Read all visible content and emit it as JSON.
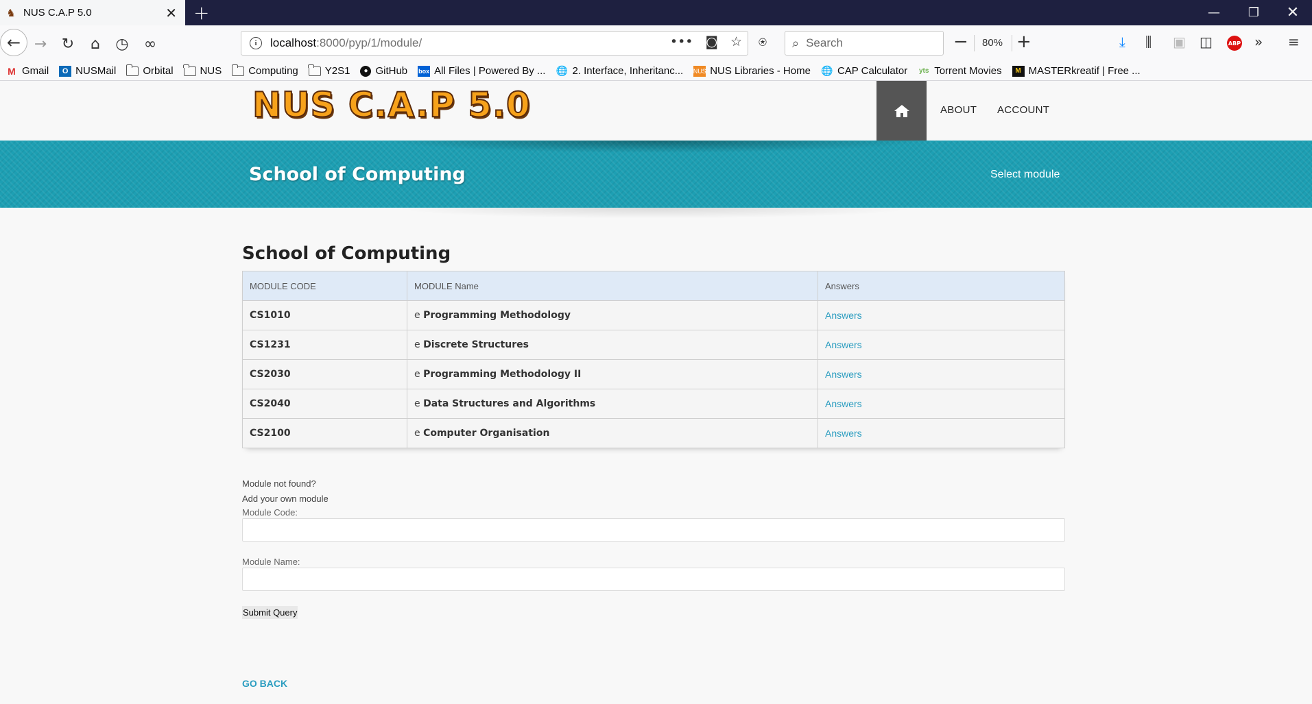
{
  "browser": {
    "tab_title": "NUS C.A.P 5.0",
    "url_host": "localhost",
    "url_path": ":8000/pyp/1/module/",
    "search_placeholder": "Search",
    "zoom": "80%",
    "abp_label": "ABP"
  },
  "bookmarks": [
    {
      "label": "Gmail",
      "icon": "gmail-icon"
    },
    {
      "label": "NUSMail",
      "icon": "outlook-icon"
    },
    {
      "label": "Orbital",
      "icon": "folder-icon"
    },
    {
      "label": "NUS",
      "icon": "folder-icon"
    },
    {
      "label": "Computing",
      "icon": "folder-icon"
    },
    {
      "label": "Y2S1",
      "icon": "folder-icon"
    },
    {
      "label": "GitHub",
      "icon": "github-icon"
    },
    {
      "label": "All Files | Powered By ...",
      "icon": "box-icon"
    },
    {
      "label": "2. Interface, Inheritanc...",
      "icon": "globe-icon"
    },
    {
      "label": "NUS Libraries - Home",
      "icon": "library-icon"
    },
    {
      "label": "CAP Calculator",
      "icon": "globe-icon"
    },
    {
      "label": "Torrent Movies",
      "icon": "yts-icon"
    },
    {
      "label": "MASTERkreatif | Free ...",
      "icon": "mk-icon"
    }
  ],
  "site": {
    "logo_text": "NUS C.A.P 5.0",
    "nav": {
      "about": "ABOUT",
      "account": "ACCOUNT"
    },
    "banner_title": "School of Computing",
    "banner_sub": "Select module"
  },
  "main": {
    "title": "School of Computing",
    "table": {
      "headers": [
        "MODULE CODE",
        "MODULE Name",
        "Answers"
      ],
      "rows": [
        {
          "code": "CS1010",
          "prefix": "e",
          "name": "Programming Methodology",
          "answers": "Answers"
        },
        {
          "code": "CS1231",
          "prefix": "e",
          "name": "Discrete Structures",
          "answers": "Answers"
        },
        {
          "code": "CS2030",
          "prefix": "e",
          "name": "Programming Methodology II",
          "answers": "Answers"
        },
        {
          "code": "CS2040",
          "prefix": "e",
          "name": "Data Structures and Algorithms",
          "answers": "Answers"
        },
        {
          "code": "CS2100",
          "prefix": "e",
          "name": "Computer Organisation",
          "answers": "Answers"
        }
      ]
    },
    "form": {
      "not_found": "Module not found?",
      "add_own": "Add your own module",
      "code_label": "Module Code:",
      "code_value": "",
      "name_label": "Module Name:",
      "name_value": "",
      "submit": "Submit Query"
    },
    "go_back": "GO BACK"
  },
  "colors": {
    "banner": "#1d9fb3",
    "link": "#2b9dc0",
    "table_header": "#dfeaf7",
    "titlebar": "#1e2040"
  }
}
